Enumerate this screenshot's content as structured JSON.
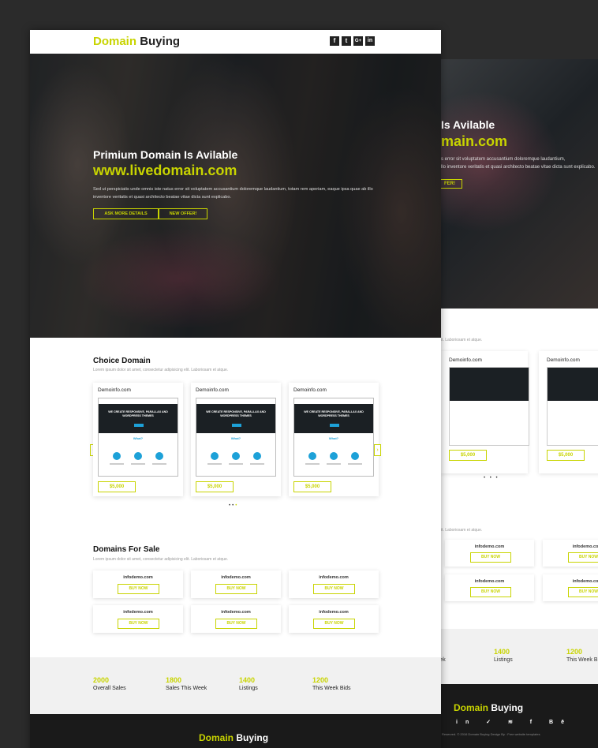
{
  "brand": {
    "name_accent": "Domain",
    "name_rest": "Buying",
    "accent_color": "#c8d400"
  },
  "header": {
    "social": [
      "f",
      "t",
      "G+",
      "in"
    ]
  },
  "hero": {
    "subtitle": "Primium Domain Is Avilable",
    "title": "www.livedomain.com",
    "paragraph": "Sed ut perspiciatis unde omnis iste natus error sit voluptatem accusantium doloremque laudantium, totam rem aperiam, eaque ipsa quae ab illo inventore veritatis et quasi architecto beatae vitae dicta sunt explicabo.",
    "btn_details": "ASK MORE DETAILS",
    "btn_offer": "NEW OFFER!"
  },
  "choice": {
    "heading": "Choice Domain",
    "sub": "Lorem ipsum dolor sit amet, consectetur adipisicing elit. Laboriosam et atque.",
    "cards": [
      {
        "title": "Demoinfo.com",
        "price": "$5,000"
      },
      {
        "title": "Demoinfo.com",
        "price": "$5,000"
      },
      {
        "title": "Demoinfo.com",
        "price": "$5,000"
      }
    ],
    "shot_headline": "WE CREATE RESPONSIVE, PARALLAX AND WORDPRESS THEMES",
    "shot_what": "What?",
    "arrow_left": "‹",
    "arrow_right": "›",
    "dots": "• • •"
  },
  "sale": {
    "heading": "Domains For Sale",
    "sub": "Lorem ipsum dolor sit amet, consectetur adipisicing elit. Laboriosam et atque.",
    "items": [
      {
        "name": "infodemo.com",
        "btn": "BUY NOW"
      },
      {
        "name": "infodemo.com",
        "btn": "BUY NOW"
      },
      {
        "name": "infodemo.com",
        "btn": "BUY NOW"
      },
      {
        "name": "infodemo.com",
        "btn": "BUY NOW"
      },
      {
        "name": "infodemo.com",
        "btn": "BUY NOW"
      },
      {
        "name": "infodemo.com",
        "btn": "BUY NOW"
      }
    ]
  },
  "stats": [
    {
      "value": "2000",
      "label": "Overall Sales"
    },
    {
      "value": "1800",
      "label": "Sales This Week"
    },
    {
      "value": "1400",
      "label": "Listings"
    },
    {
      "value": "1200",
      "label": "This Week Bids"
    }
  ],
  "back_page": {
    "hero_sub": "Is Avilable",
    "hero_title": "main.com",
    "hero_p1": "s error sit voluptatem accusantium doloremque laudantium,",
    "hero_p2": "llo inventore veritatis et quasi architecto beatae vitae dicta sunt explicabo.",
    "hero_btn": "FER!",
    "choice_sub": "it. Laboriosam et atque.",
    "card_title": "Demoinfo.com",
    "card_price": "$5,000",
    "dots": "• • •",
    "sale_sub": "it. Laboriosam et atque.",
    "sale_name": "infodemo.com",
    "sale_btn": "BUY NOW",
    "stat1_label": "is Week",
    "stat2_value": "1400",
    "stat2_label": "Listings",
    "stat3_value": "1200",
    "stat3_label": "This Week B",
    "footer_social": "in ✓ ≋ f Bē",
    "copyright": "Reserved. © 2016 Domain Buying Design By : Free website templates"
  }
}
